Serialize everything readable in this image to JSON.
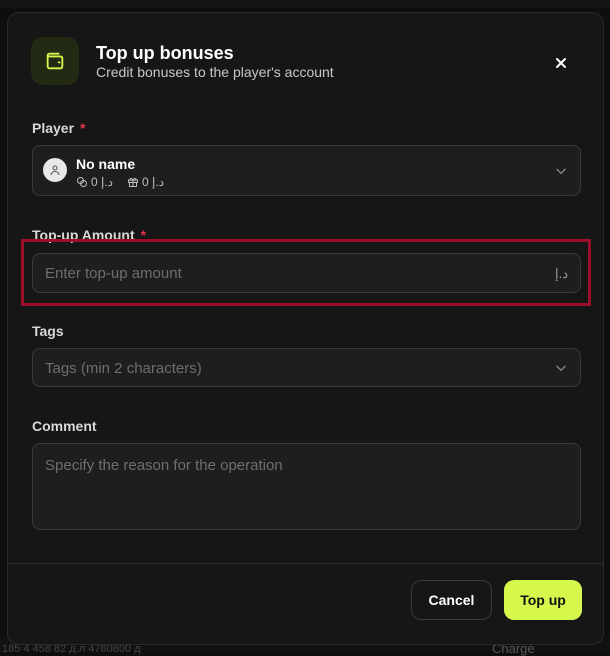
{
  "modal": {
    "title": "Top up bonuses",
    "subtitle": "Credit bonuses to the player's account",
    "icon": "wallet-icon",
    "accent_color": "#d6f84c"
  },
  "player": {
    "label": "Player",
    "required_mark": "*",
    "name": "No name",
    "balance": "0 د.إ",
    "bonus": "0 د.إ"
  },
  "amount": {
    "label": "Top-up Amount",
    "required_mark": "*",
    "placeholder": "Enter top-up amount",
    "currency": "د.إ"
  },
  "tags": {
    "label": "Tags",
    "placeholder": "Tags (min 2 characters)"
  },
  "comment": {
    "label": "Comment",
    "placeholder": "Specify the reason for the operation"
  },
  "actions": {
    "cancel": "Cancel",
    "submit": "Top up"
  },
  "background": {
    "bottom_left_text": "185 4 458 82 д.л 4780800 д",
    "bottom_right_text": "Charge"
  }
}
